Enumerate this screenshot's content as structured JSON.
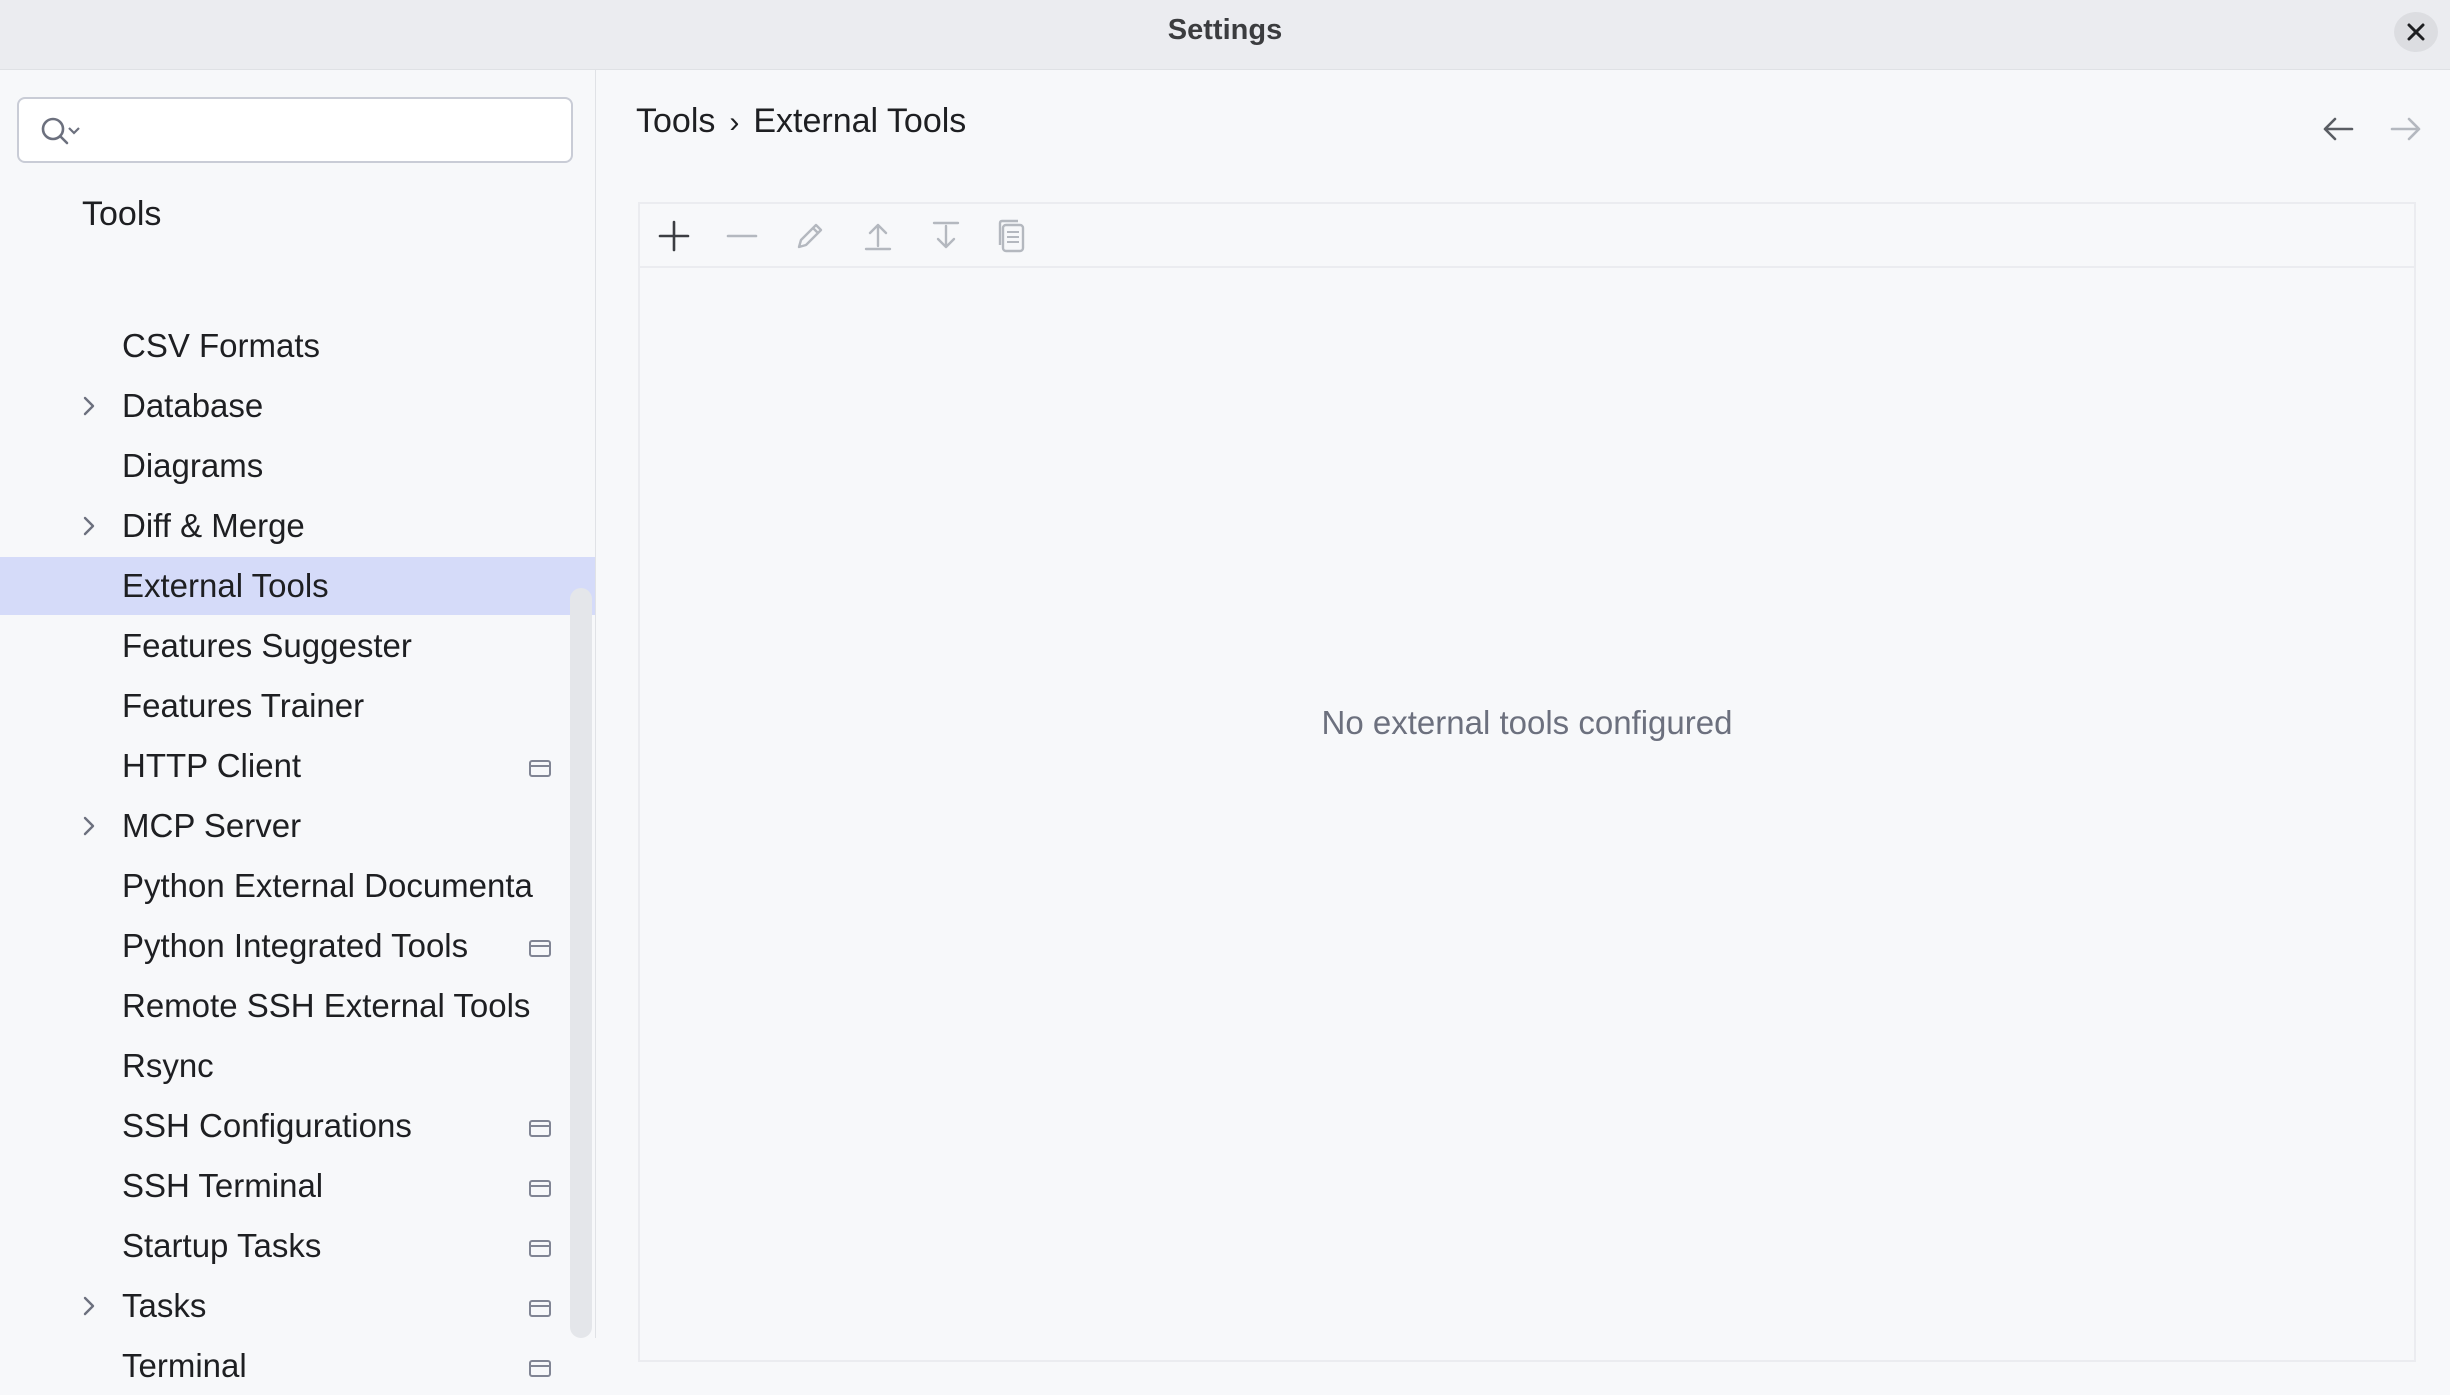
{
  "window": {
    "title": "Settings"
  },
  "search": {
    "placeholder": "",
    "value": ""
  },
  "sidebar": {
    "section_title": "Tools",
    "items": [
      {
        "label": "CSV Formats",
        "expandable": false,
        "badge": false,
        "selected": false
      },
      {
        "label": "Database",
        "expandable": true,
        "badge": false,
        "selected": false
      },
      {
        "label": "Diagrams",
        "expandable": false,
        "badge": false,
        "selected": false
      },
      {
        "label": "Diff & Merge",
        "expandable": true,
        "badge": false,
        "selected": false
      },
      {
        "label": "External Tools",
        "expandable": false,
        "badge": false,
        "selected": true
      },
      {
        "label": "Features Suggester",
        "expandable": false,
        "badge": false,
        "selected": false
      },
      {
        "label": "Features Trainer",
        "expandable": false,
        "badge": false,
        "selected": false
      },
      {
        "label": "HTTP Client",
        "expandable": false,
        "badge": true,
        "selected": false
      },
      {
        "label": "MCP Server",
        "expandable": true,
        "badge": false,
        "selected": false
      },
      {
        "label": "Python External Documenta",
        "expandable": false,
        "badge": false,
        "selected": false
      },
      {
        "label": "Python Integrated Tools",
        "expandable": false,
        "badge": true,
        "selected": false
      },
      {
        "label": "Remote SSH External Tools",
        "expandable": false,
        "badge": false,
        "selected": false
      },
      {
        "label": "Rsync",
        "expandable": false,
        "badge": false,
        "selected": false
      },
      {
        "label": "SSH Configurations",
        "expandable": false,
        "badge": true,
        "selected": false
      },
      {
        "label": "SSH Terminal",
        "expandable": false,
        "badge": true,
        "selected": false
      },
      {
        "label": "Startup Tasks",
        "expandable": false,
        "badge": true,
        "selected": false
      },
      {
        "label": "Tasks",
        "expandable": true,
        "badge": true,
        "selected": false
      },
      {
        "label": "Terminal",
        "expandable": false,
        "badge": true,
        "selected": false
      }
    ]
  },
  "breadcrumb": {
    "parent": "Tools",
    "separator": "›",
    "current": "External Tools"
  },
  "toolbar": {
    "buttons": [
      "add-icon",
      "remove-icon",
      "edit-icon",
      "move-up-icon",
      "move-down-icon",
      "copy-icon"
    ]
  },
  "main": {
    "empty_text": "No external tools configured"
  },
  "colors": {
    "selection": "#d5dbf9",
    "background": "#f7f8fa",
    "titlebar": "#ebecf0"
  }
}
